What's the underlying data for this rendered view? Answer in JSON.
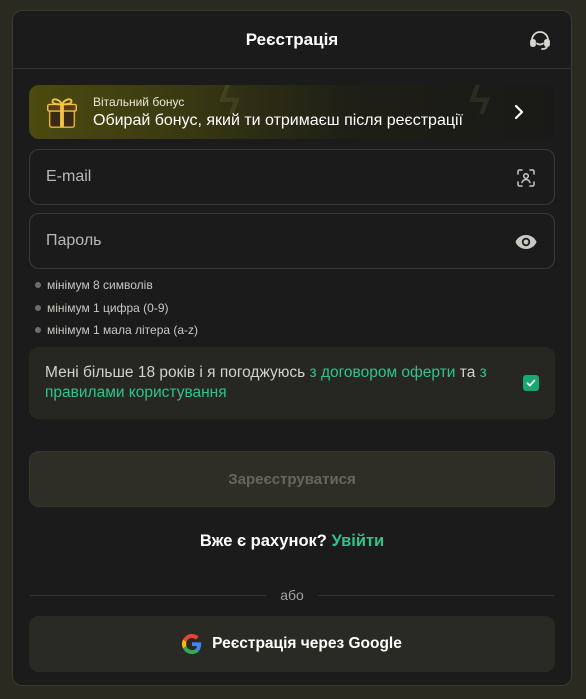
{
  "header": {
    "title": "Реєстрація",
    "support_icon": "headset-icon"
  },
  "bonus": {
    "label": "Вітальний бонус",
    "text": "Обирай бонус, який ти отримаєш після реєстрації",
    "icon": "gift-icon"
  },
  "form": {
    "email_placeholder": "E-mail",
    "password_placeholder": "Пароль",
    "email_icon": "scan-face-icon",
    "password_icon": "eye-icon"
  },
  "password_rules": [
    "мінімум 8 символів",
    "мінімум 1 цифра (0-9)",
    "мінімум 1 мала літера (a-z)"
  ],
  "agreement": {
    "text_before": "Мені більше 18 років і я погоджуюсь ",
    "link1": "з договором оферти",
    "text_middle": " та ",
    "link2": "з правилами користування",
    "checked": true
  },
  "submit_label": "Зареєструватися",
  "login": {
    "question": "Вже є рахунок?",
    "link": "Увійти"
  },
  "divider_label": "або",
  "google_label": "Реєстрація через Google",
  "colors": {
    "accent_green": "#2fc38c",
    "checkbox_green": "#16a86e",
    "modal_bg": "#1b1b1b"
  }
}
